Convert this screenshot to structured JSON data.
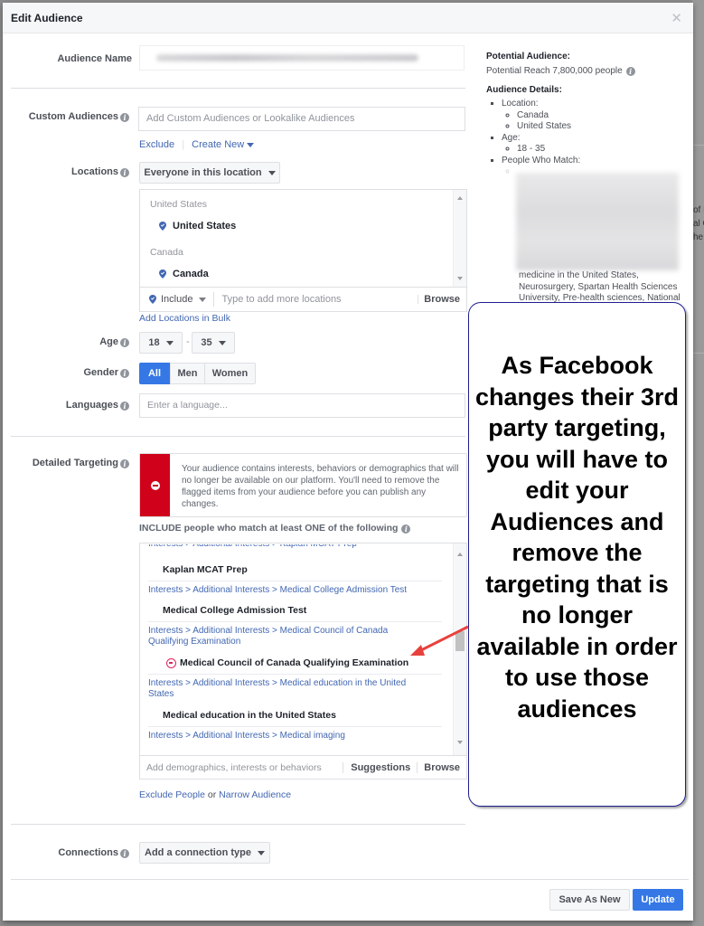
{
  "background": {
    "right_text_lines": [
      "of M",
      "al C",
      "he"
    ]
  },
  "dialog": {
    "title": "Edit Audience",
    "close_icon": "close-icon"
  },
  "form": {
    "audience_name": {
      "label": "Audience Name",
      "value_blurred": true
    },
    "custom_audiences": {
      "label": "Custom Audiences",
      "placeholder": "Add Custom Audiences or Lookalike Audiences",
      "exclude_link": "Exclude",
      "create_new_link": "Create New"
    },
    "locations": {
      "label": "Locations",
      "dropdown_value": "Everyone in this location",
      "groups": [
        {
          "group": "United States",
          "item": "United States"
        },
        {
          "group": "Canada",
          "item": "Canada"
        }
      ],
      "include_label": "Include",
      "input_placeholder": "Type to add more locations",
      "browse_label": "Browse",
      "bulk_link": "Add Locations in Bulk"
    },
    "age": {
      "label": "Age",
      "min": "18",
      "max": "35",
      "separator": "-"
    },
    "gender": {
      "label": "Gender",
      "options": [
        "All",
        "Men",
        "Women"
      ],
      "selected": "All"
    },
    "languages": {
      "label": "Languages",
      "placeholder": "Enter a language..."
    },
    "detailed_targeting": {
      "label": "Detailed Targeting",
      "warning": "Your audience contains interests, behaviors or demographics that will no longer be available on our platform. You'll need to remove the flagged items from your audience before you can publish any changes.",
      "include_heading": "INCLUDE people who match at least ONE of the following",
      "items": [
        {
          "crumb": "Interests > Additional Interests > Kaplan MCAT Prep",
          "name": "Kaplan MCAT Prep",
          "flagged": false
        },
        {
          "crumb": "Interests > Additional Interests > Medical College Admission Test",
          "name": "Medical College Admission Test",
          "flagged": false
        },
        {
          "crumb": "Interests > Additional Interests > Medical Council of Canada Qualifying Examination",
          "name": "Medical Council of Canada Qualifying Examination",
          "flagged": true
        },
        {
          "crumb": "Interests > Additional Interests > Medical education in the United States",
          "name": "Medical education in the United States",
          "flagged": false
        },
        {
          "crumb": "Interests > Additional Interests > Medical imaging",
          "name": "",
          "flagged": false
        }
      ],
      "input_placeholder": "Add demographics, interests or behaviors",
      "suggestions_label": "Suggestions",
      "browse_label": "Browse",
      "exclude_people_link": "Exclude People",
      "or_text": "or",
      "narrow_audience_link": "Narrow Audience"
    },
    "connections": {
      "label": "Connections",
      "dropdown_value": "Add a connection type"
    }
  },
  "summary": {
    "potential_audience_heading": "Potential Audience:",
    "potential_reach": "Potential Reach 7,800,000 people",
    "details_heading": "Audience Details:",
    "location_label": "Location:",
    "locations": [
      "Canada",
      "United States"
    ],
    "age_label": "Age:",
    "age_range": "18 - 35",
    "people_who_match_label": "People Who Match:",
    "match_tail": "medicine in the United States, Neurosurgery, Spartan Health Sciences University, Pre-health sciences, National"
  },
  "footer": {
    "save_as_new": "Save As New",
    "update": "Update"
  },
  "annotation": {
    "text": "As Facebook changes their 3rd party targeting, you will have to edit your Audiences and remove the targeting that is no longer available in order to use those audiences",
    "border_color": "#1f1f8f",
    "arrow_color": "#e8413c"
  },
  "colors": {
    "link": "#4267b2",
    "primary": "#3578e5",
    "warning_red": "#d0021b",
    "flag_red": "#e0245e"
  }
}
